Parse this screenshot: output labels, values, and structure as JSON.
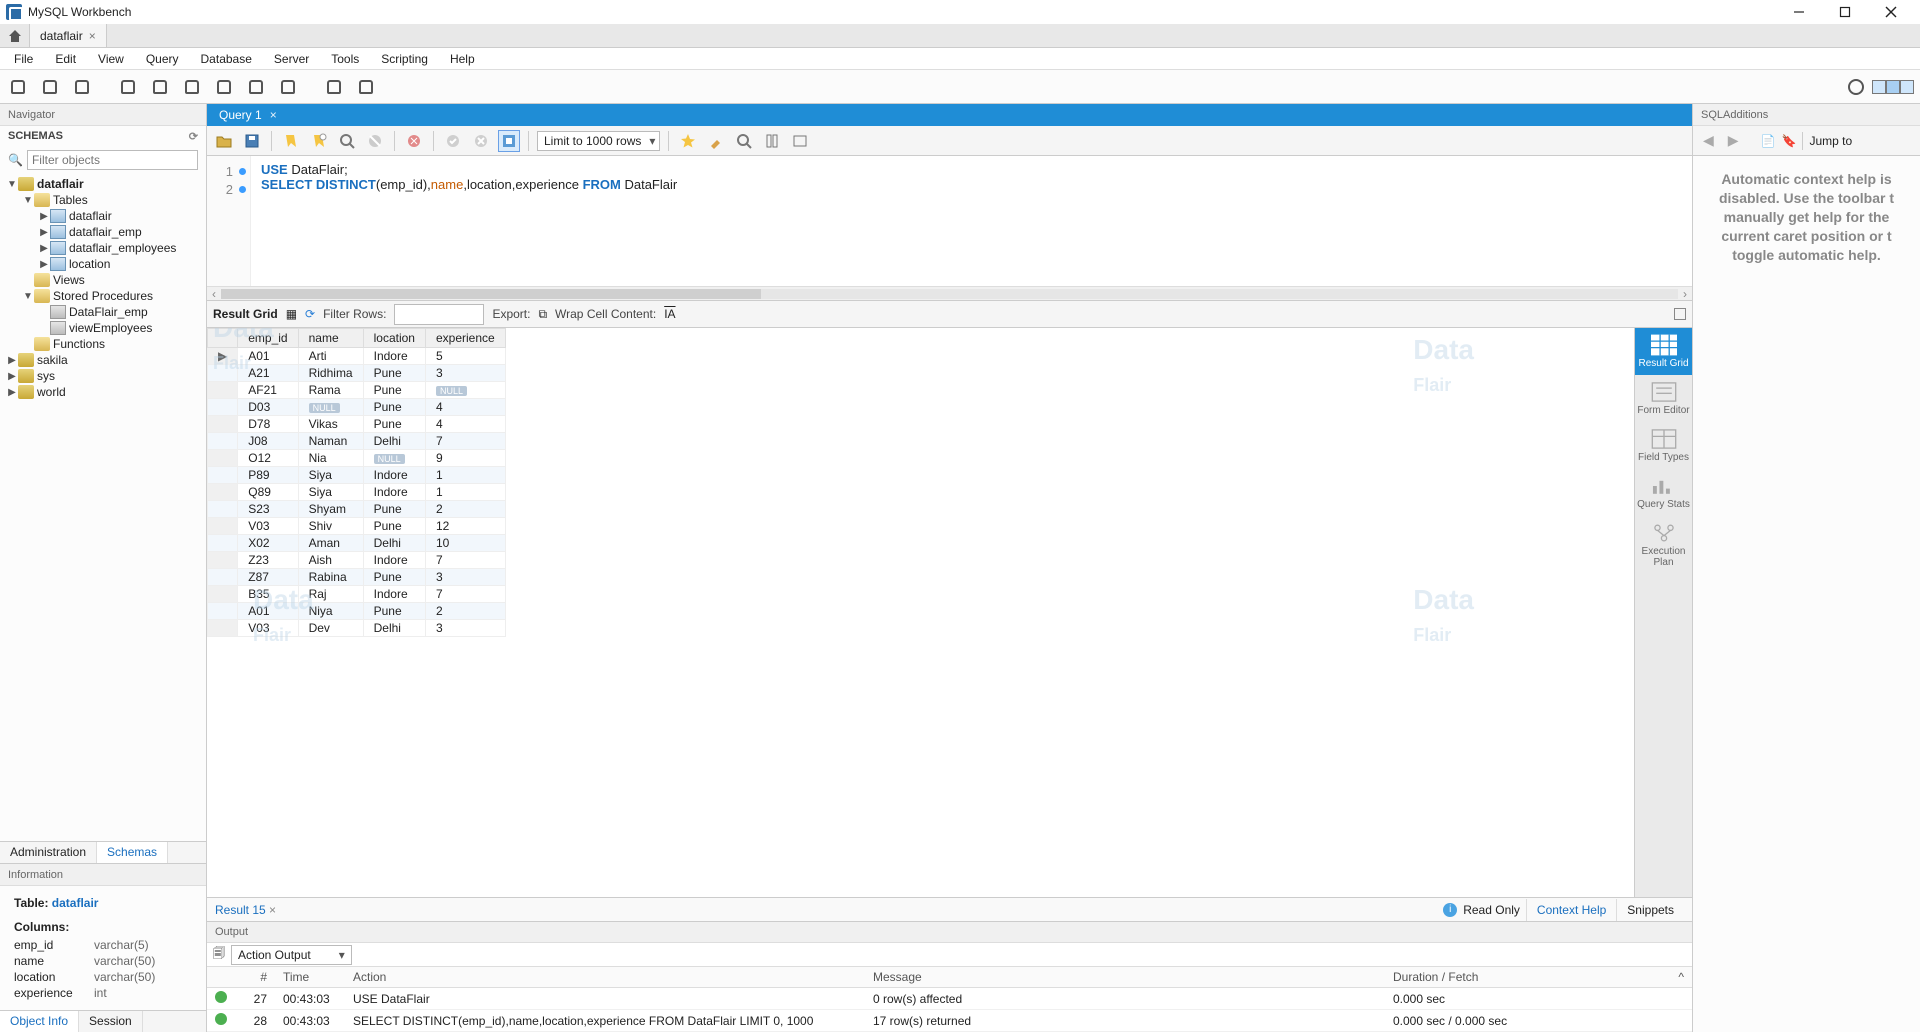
{
  "app": {
    "title": "MySQL Workbench"
  },
  "connection_tab": {
    "name": "dataflair"
  },
  "menu": [
    "File",
    "Edit",
    "View",
    "Query",
    "Database",
    "Server",
    "Tools",
    "Scripting",
    "Help"
  ],
  "navigator": {
    "panel_title": "Navigator",
    "schemas_label": "SCHEMAS",
    "filter_placeholder": "Filter objects",
    "tree": {
      "db": "dataflair",
      "tables_label": "Tables",
      "tables": [
        "dataflair",
        "dataflair_emp",
        "dataflair_employees",
        "location"
      ],
      "views_label": "Views",
      "stored_label": "Stored Procedures",
      "procs": [
        "DataFlair_emp",
        "viewEmployees"
      ],
      "functions_label": "Functions",
      "other_dbs": [
        "sakila",
        "sys",
        "world"
      ]
    },
    "tabs": {
      "admin": "Administration",
      "schemas": "Schemas"
    }
  },
  "info": {
    "panel_title": "Information",
    "table_label": "Table:",
    "table_name": "dataflair",
    "columns_label": "Columns:",
    "columns": [
      {
        "name": "emp_id",
        "type": "varchar(5)"
      },
      {
        "name": "name",
        "type": "varchar(50)"
      },
      {
        "name": "location",
        "type": "varchar(50)"
      },
      {
        "name": "experience",
        "type": "int"
      }
    ],
    "tabs": {
      "object": "Object Info",
      "session": "Session"
    }
  },
  "query_tab": {
    "label": "Query 1"
  },
  "editor_toolbar": {
    "limit": "Limit to 1000 rows"
  },
  "sql": {
    "line1": {
      "kw1": "USE",
      "rest": " DataFlair;"
    },
    "line2": {
      "kw1": "SELECT",
      "kw2": "DISTINCT",
      "open": "(emp_id),",
      "name": "name",
      "mid": ",location,experience ",
      "kw3": "FROM",
      "tbl": " DataFlair"
    }
  },
  "result_toolbar": {
    "label": "Result Grid",
    "filter_label": "Filter Rows:",
    "export_label": "Export:",
    "wrap_label": "Wrap Cell Content:"
  },
  "columns": [
    "emp_id",
    "name",
    "location",
    "experience"
  ],
  "rows": [
    {
      "emp_id": "A01",
      "name": "Arti",
      "location": "Indore",
      "experience": "5"
    },
    {
      "emp_id": "A21",
      "name": "Ridhima",
      "location": "Pune",
      "experience": "3"
    },
    {
      "emp_id": "AF21",
      "name": "Rama",
      "location": "Pune",
      "experience": null
    },
    {
      "emp_id": "D03",
      "name": null,
      "location": "Pune",
      "experience": "4"
    },
    {
      "emp_id": "D78",
      "name": "Vikas",
      "location": "Pune",
      "experience": "4"
    },
    {
      "emp_id": "J08",
      "name": "Naman",
      "location": "Delhi",
      "experience": "7"
    },
    {
      "emp_id": "O12",
      "name": "Nia",
      "location": null,
      "experience": "9"
    },
    {
      "emp_id": "P89",
      "name": "Siya",
      "location": "Indore",
      "experience": "1"
    },
    {
      "emp_id": "Q89",
      "name": "Siya",
      "location": "Indore",
      "experience": "1"
    },
    {
      "emp_id": "S23",
      "name": "Shyam",
      "location": "Pune",
      "experience": "2"
    },
    {
      "emp_id": "V03",
      "name": "Shiv",
      "location": "Pune",
      "experience": "12"
    },
    {
      "emp_id": "X02",
      "name": "Aman",
      "location": "Delhi",
      "experience": "10"
    },
    {
      "emp_id": "Z23",
      "name": "Aish",
      "location": "Indore",
      "experience": "7"
    },
    {
      "emp_id": "Z87",
      "name": "Rabina",
      "location": "Pune",
      "experience": "3"
    },
    {
      "emp_id": "B35",
      "name": "Raj",
      "location": "Indore",
      "experience": "7"
    },
    {
      "emp_id": "A01",
      "name": "Niya",
      "location": "Pune",
      "experience": "2"
    },
    {
      "emp_id": "V03",
      "name": "Dev",
      "location": "Delhi",
      "experience": "3"
    }
  ],
  "right_tools": {
    "result_grid": "Result Grid",
    "form_editor": "Form Editor",
    "field_types": "Field Types",
    "query_stats": "Query Stats",
    "execution_plan": "Execution Plan"
  },
  "result_bottom": {
    "tab": "Result 15",
    "readonly": "Read Only",
    "context_help": "Context Help",
    "snippets": "Snippets"
  },
  "output": {
    "header": "Output",
    "selector": "Action Output",
    "cols": {
      "num": "#",
      "time": "Time",
      "action": "Action",
      "message": "Message",
      "duration": "Duration / Fetch"
    },
    "rows": [
      {
        "num": "27",
        "time": "00:43:03",
        "action": "USE DataFlair",
        "message": "0 row(s) affected",
        "duration": "0.000 sec"
      },
      {
        "num": "28",
        "time": "00:43:03",
        "action": "SELECT DISTINCT(emp_id),name,location,experience FROM DataFlair LIMIT 0, 1000",
        "message": "17 row(s) returned",
        "duration": "0.000 sec / 0.000 sec"
      }
    ]
  },
  "additions": {
    "title": "SQLAdditions",
    "jump": "Jump to",
    "help_text": "Automatic context help is disabled. Use the toolbar t manually get help for the current caret position or t toggle automatic help."
  }
}
